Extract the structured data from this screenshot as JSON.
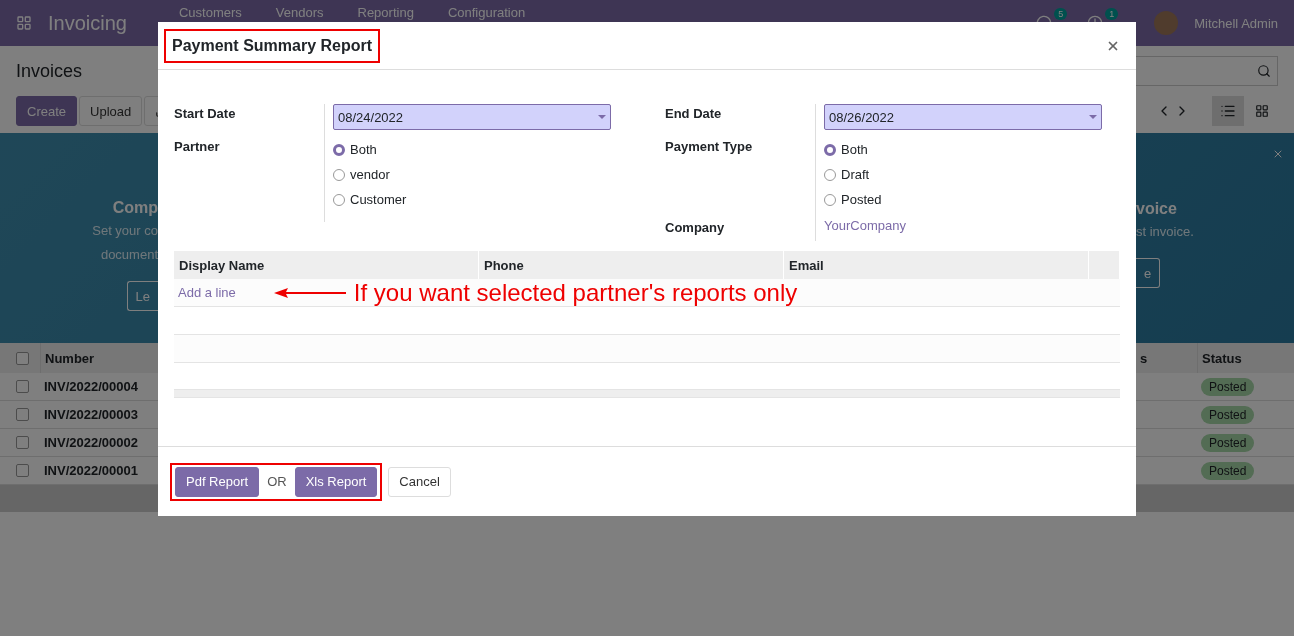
{
  "app_bar": {
    "app_name": "Invoicing",
    "menu": [
      "Customers",
      "Vendors",
      "Reporting",
      "Configuration"
    ],
    "messages_count": "5",
    "activity_count": "1",
    "user": "Mitchell Admin"
  },
  "control_panel": {
    "title": "Invoices",
    "buttons": [
      "Create",
      "Upload"
    ]
  },
  "banner": {
    "left_title": "Comp",
    "left_lines": [
      "Set your co",
      "document"
    ],
    "left_button": "Le",
    "right_title": "voice",
    "right_line": "st invoice.",
    "right_button": "e"
  },
  "list": {
    "select_all_checked": false,
    "columns": [
      "Number",
      "s",
      "Status"
    ],
    "rows": [
      {
        "number": "INV/2022/00004",
        "status": "Posted",
        "checked": false
      },
      {
        "number": "INV/2022/00003",
        "status": "Posted",
        "checked": false
      },
      {
        "number": "INV/2022/00002",
        "status": "Posted",
        "checked": false
      },
      {
        "number": "INV/2022/00001",
        "status": "Posted",
        "checked": false
      }
    ]
  },
  "dialog": {
    "title": "Payment Summary Report",
    "start_date": {
      "label": "Start Date",
      "value": "08/24/2022"
    },
    "end_date": {
      "label": "End Date",
      "value": "08/26/2022"
    },
    "partner": {
      "label": "Partner",
      "options": [
        {
          "label": "Both",
          "selected": true
        },
        {
          "label": "vendor",
          "selected": false
        },
        {
          "label": "Customer",
          "selected": false
        }
      ]
    },
    "payment_type": {
      "label": "Payment Type",
      "options": [
        {
          "label": "Both",
          "selected": true
        },
        {
          "label": "Draft",
          "selected": false
        },
        {
          "label": "Posted",
          "selected": false
        }
      ]
    },
    "company": {
      "label": "Company",
      "value": "YourCompany"
    },
    "table": {
      "columns": [
        "Display Name",
        "Phone",
        "Email"
      ],
      "add_line": "Add a line"
    },
    "annotation": "If you want selected partner's reports only",
    "footer": {
      "pdf": "Pdf Report",
      "separator": "OR",
      "xls": "Xls Report",
      "cancel": "Cancel"
    }
  }
}
